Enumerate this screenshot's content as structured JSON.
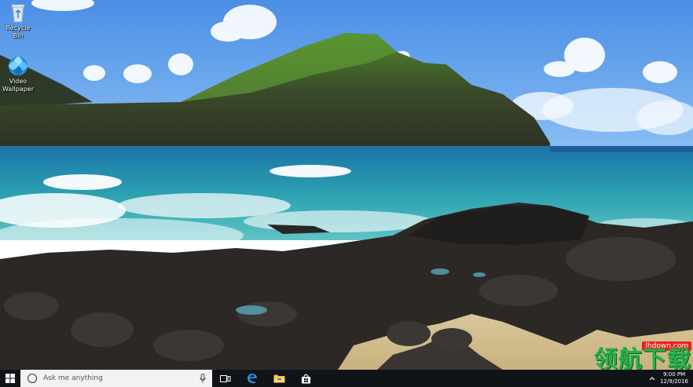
{
  "desktop": {
    "icons": [
      {
        "label": "Recycle Bin",
        "icon": "recycle-bin-icon"
      },
      {
        "label": "Video Wallpaper",
        "icon": "video-wallpaper-icon"
      }
    ]
  },
  "watermark": {
    "domain": "lhdown.com",
    "brand": "领航下载"
  },
  "taskbar": {
    "start_icon": "windows-logo-icon",
    "search_placeholder": "Ask me anything",
    "apps": [
      "task-view-icon",
      "edge-icon",
      "file-explorer-icon",
      "store-icon"
    ],
    "clock_time": "9:00 PM",
    "clock_date": "12/9/2016"
  }
}
